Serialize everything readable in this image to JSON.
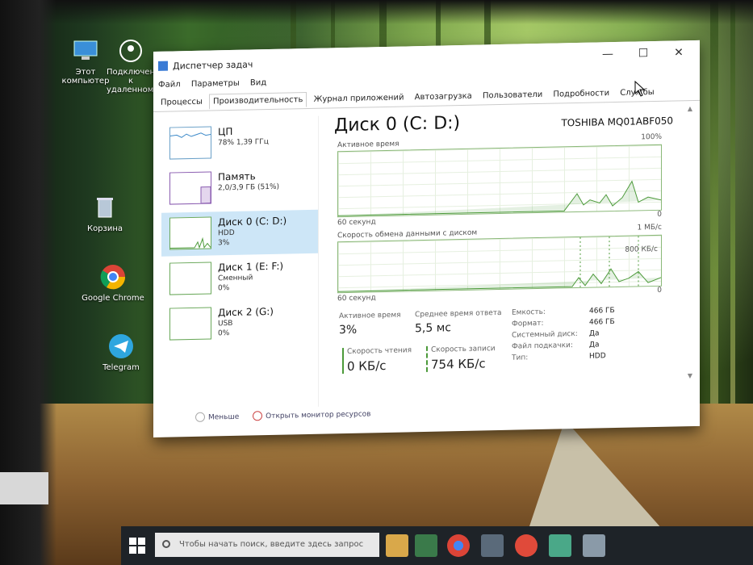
{
  "desktop_icons": [
    {
      "label": "Этот компьютер"
    },
    {
      "label": "Подключение к удаленному"
    },
    {
      "label": "Корзина"
    },
    {
      "label": "Google Chrome"
    },
    {
      "label": "Telegram"
    }
  ],
  "window": {
    "title": "Диспетчер задач",
    "controls": {
      "minimize": "—",
      "maximize": "☐",
      "close": "✕"
    }
  },
  "menu": [
    "Файл",
    "Параметры",
    "Вид"
  ],
  "tabs": [
    {
      "label": "Процессы",
      "active": false
    },
    {
      "label": "Производительность",
      "active": true
    },
    {
      "label": "Журнал приложений",
      "active": false
    },
    {
      "label": "Автозагрузка",
      "active": false
    },
    {
      "label": "Пользователи",
      "active": false
    },
    {
      "label": "Подробности",
      "active": false
    },
    {
      "label": "Службы",
      "active": false
    }
  ],
  "resources": [
    {
      "name": "ЦП",
      "sub": "78% 1,39 ГГц",
      "sub2": "",
      "selected": false
    },
    {
      "name": "Память",
      "sub": "2,0/3,9 ГБ (51%)",
      "sub2": "",
      "selected": false
    },
    {
      "name": "Диск 0 (C: D:)",
      "sub": "HDD",
      "sub2": "3%",
      "selected": true
    },
    {
      "name": "Диск 1 (E: F:)",
      "sub": "Сменный",
      "sub2": "0%",
      "selected": false
    },
    {
      "name": "Диск 2 (G:)",
      "sub": "USB",
      "sub2": "0%",
      "selected": false
    }
  ],
  "detail": {
    "title": "Диск 0 (C: D:)",
    "model": "TOSHIBA MQ01ABF050",
    "graph1": {
      "label": "Активное время",
      "max": "100%",
      "duration": "60 секунд",
      "min": "0"
    },
    "graph2": {
      "label": "Скорость обмена данными с диском",
      "max": "1 МБ/с",
      "mid": "800 КБ/с",
      "duration": "60 секунд",
      "min": "0"
    },
    "stats": {
      "active_time_label": "Активное время",
      "active_time_value": "3%",
      "avg_response_label": "Среднее время ответа",
      "avg_response_value": "5,5 мс",
      "read_label": "Скорость чтения",
      "read_value": "0 КБ/с",
      "write_label": "Скорость записи",
      "write_value": "754 КБ/с"
    },
    "properties": [
      {
        "key": "Емкость:",
        "value": "466 ГБ"
      },
      {
        "key": "Формат:",
        "value": "466 ГБ"
      },
      {
        "key": "Системный диск:",
        "value": "Да"
      },
      {
        "key": "Файл подкачки:",
        "value": "Да"
      },
      {
        "key": "Тип:",
        "value": "HDD"
      }
    ]
  },
  "footer": {
    "less_label": "Меньше",
    "resmon_label": "Открыть монитор ресурсов"
  },
  "taskbar": {
    "search_placeholder": "Чтобы начать поиск, введите здесь запрос"
  },
  "colors": {
    "selected_bg": "#cde6f7",
    "disk_graph": "#4c9a3a",
    "taskbar": "#1e2328"
  }
}
